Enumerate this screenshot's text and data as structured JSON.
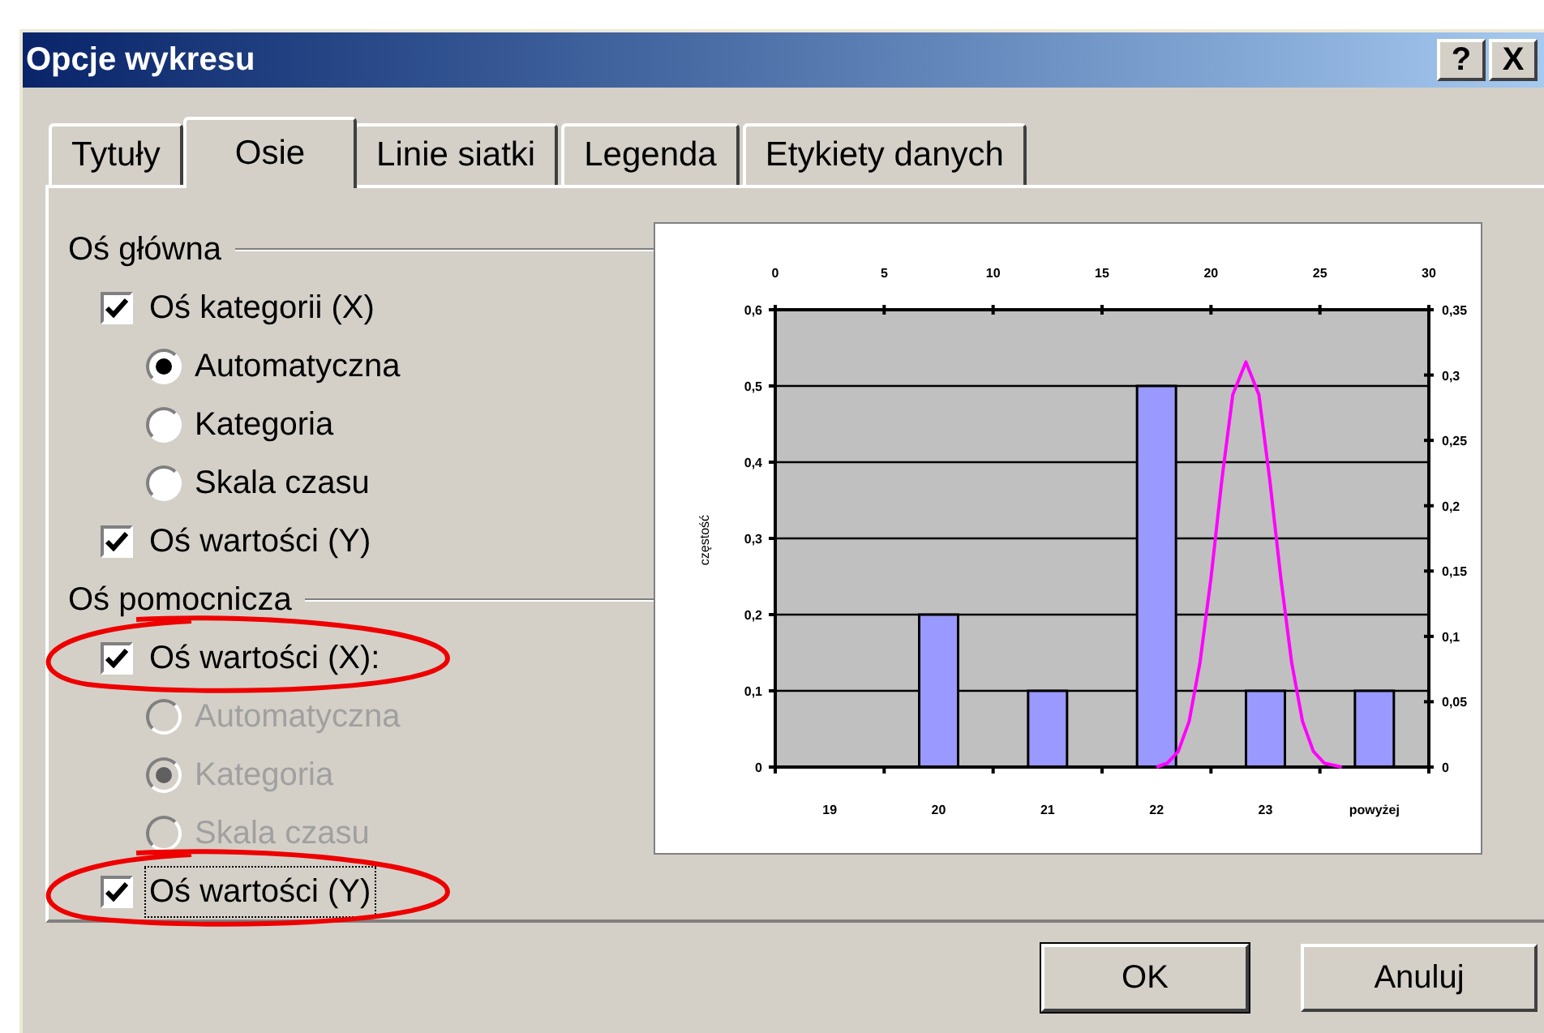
{
  "window": {
    "title": "Opcje wykresu",
    "title_buttons": [
      "?",
      "X"
    ]
  },
  "tabs": [
    {
      "label": "Tytuły",
      "selected": false
    },
    {
      "label": "Osie",
      "selected": true
    },
    {
      "label": "Linie siatki",
      "selected": false
    },
    {
      "label": "Legenda",
      "selected": false
    },
    {
      "label": "Etykiety danych",
      "selected": false
    }
  ],
  "groups": [
    {
      "title": "Oś główna",
      "items": [
        {
          "kind": "checkbox",
          "label": "Oś kategorii (X)",
          "checked": true,
          "disabled": false,
          "focused": false
        },
        {
          "kind": "radio",
          "label": "Automatyczna",
          "selected": true,
          "disabled": false,
          "focused": false
        },
        {
          "kind": "radio",
          "label": "Kategoria",
          "selected": false,
          "disabled": false,
          "focused": false
        },
        {
          "kind": "radio",
          "label": "Skala czasu",
          "selected": false,
          "disabled": false,
          "focused": false
        },
        {
          "kind": "checkbox",
          "label": "Oś wartości (Y)",
          "checked": true,
          "disabled": false,
          "focused": false
        }
      ]
    },
    {
      "title": "Oś pomocnicza",
      "items": [
        {
          "kind": "checkbox",
          "label": "Oś wartości (X):",
          "checked": true,
          "disabled": false,
          "focused": false
        },
        {
          "kind": "radio",
          "label": "Automatyczna",
          "selected": false,
          "disabled": true,
          "focused": false
        },
        {
          "kind": "radio",
          "label": "Kategoria",
          "selected": true,
          "disabled": true,
          "focused": false
        },
        {
          "kind": "radio",
          "label": "Skala czasu",
          "selected": false,
          "disabled": true,
          "focused": false
        },
        {
          "kind": "checkbox",
          "label": "Oś wartości (Y)",
          "checked": true,
          "disabled": false,
          "focused": true
        }
      ]
    }
  ],
  "preview": {
    "chart_data": {
      "type": "bar",
      "ylabel": "częstość",
      "categories": [
        "19",
        "20",
        "21",
        "22",
        "23",
        "powyżej"
      ],
      "series": [
        {
          "color": "#9999ff",
          "values": [
            0,
            0.2,
            0.1,
            0.5,
            0.1,
            0.1
          ]
        }
      ],
      "ylim": [
        0,
        0.6
      ],
      "grid": true,
      "yticks": [
        {
          "value": 0,
          "label": "0"
        },
        {
          "value": 0.1,
          "label": "0,1"
        },
        {
          "value": 0.2,
          "label": "0,2"
        },
        {
          "value": 0.3,
          "label": "0,3"
        },
        {
          "value": 0.4,
          "label": "0,4"
        },
        {
          "value": 0.5,
          "label": "0,5"
        },
        {
          "value": 0.6,
          "label": "0,6"
        }
      ]
    },
    "overlay_chart": {
      "chart_data": {
        "type": "line",
        "x": [
          17.5,
          18,
          18.5,
          19,
          19.5,
          20,
          20.5,
          21,
          21.6,
          22.2,
          22.7,
          23.2,
          23.7,
          24.2,
          24.7,
          25.2,
          26
        ],
        "series": [
          {
            "color": "#ff00ff",
            "values": [
              0,
              0.003,
              0.012,
              0.035,
              0.08,
              0.145,
              0.22,
              0.285,
              0.31,
              0.285,
              0.22,
              0.145,
              0.08,
              0.035,
              0.012,
              0.003,
              0
            ]
          }
        ],
        "xlim": [
          0,
          30
        ],
        "ylim": [
          0,
          0.35
        ],
        "xticks": [
          {
            "value": 0,
            "label": "0"
          },
          {
            "value": 5,
            "label": "5"
          },
          {
            "value": 10,
            "label": "10"
          },
          {
            "value": 15,
            "label": "15"
          },
          {
            "value": 20,
            "label": "20"
          },
          {
            "value": 25,
            "label": "25"
          },
          {
            "value": 30,
            "label": "30"
          }
        ],
        "yticks": [
          {
            "value": 0,
            "label": "0"
          },
          {
            "value": 0.05,
            "label": "0,05"
          },
          {
            "value": 0.1,
            "label": "0,1"
          },
          {
            "value": 0.15,
            "label": "0,15"
          },
          {
            "value": 0.2,
            "label": "0,2"
          },
          {
            "value": 0.25,
            "label": "0,25"
          },
          {
            "value": 0.3,
            "label": "0,3"
          },
          {
            "value": 0.35,
            "label": "0,35"
          }
        ]
      }
    }
  },
  "buttons": [
    {
      "label": "OK"
    },
    {
      "label": "Anuluj"
    }
  ]
}
